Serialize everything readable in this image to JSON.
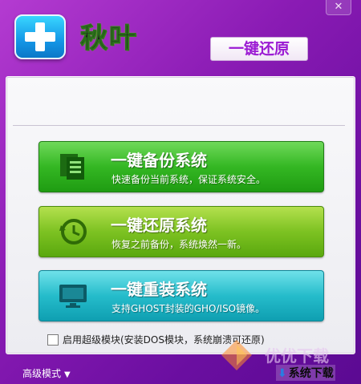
{
  "window": {
    "close_symbol": "✕"
  },
  "header": {
    "app_title": "秋叶",
    "tagline": "一键还原",
    "logo_icon": "plus-icon"
  },
  "actions": [
    {
      "title": "一键备份系统",
      "subtitle": "快速备份当前系统，保证系统安全。",
      "icon": "document-stack-icon",
      "color": "#34b723"
    },
    {
      "title": "一键还原系统",
      "subtitle": "恢复之前备份，系统焕然一新。",
      "icon": "history-clock-icon",
      "color": "#7dc222"
    },
    {
      "title": "一键重装系统",
      "subtitle": "支持GHOST封装的GHO/ISO镜像。",
      "icon": "monitor-icon",
      "color": "#25bccb"
    }
  ],
  "options": {
    "super_module_label": "启用超级模块(安装DOS模块，系统崩溃可还原)",
    "super_module_checked": false
  },
  "footer": {
    "advanced_mode": "高级模式",
    "advanced_chevron": "▼",
    "download_label": "系统下载",
    "download_arrow": "⬇",
    "watermark": "优优下载"
  }
}
